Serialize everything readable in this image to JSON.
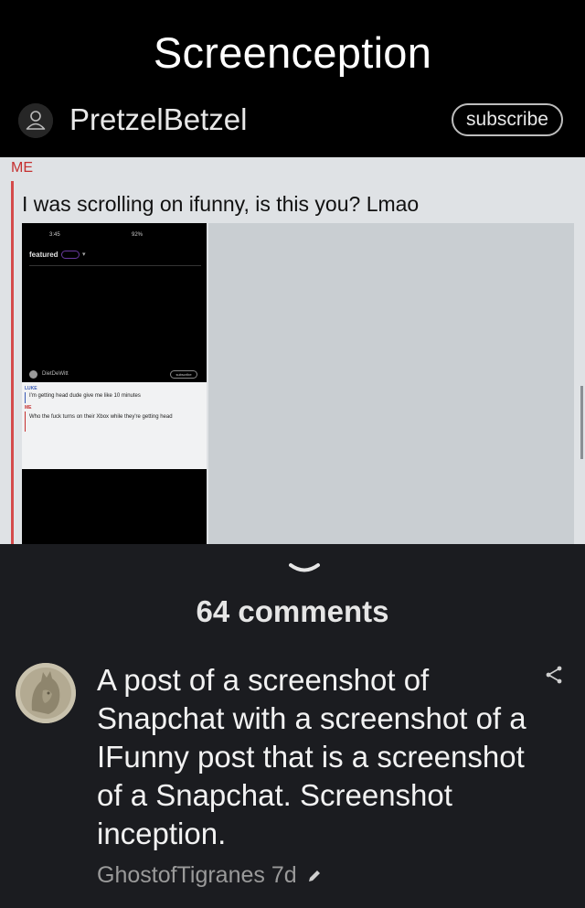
{
  "post": {
    "title": "Screenception",
    "author": "PretzelBetzel",
    "subscribe_label": "subscribe"
  },
  "snapchat": {
    "sender_label": "ME",
    "message": "I was scrolling on ifunny, is this you? Lmao",
    "nested_screenshot": {
      "status_left": "3:45",
      "status_right": "92%",
      "tab_label": "featured",
      "poster": "DietDeWitt",
      "subscribe_label": "subscribe",
      "first_sender": "LUKE",
      "first_message": "I'm getting head dude give me like 10 minutes",
      "second_sender": "ME",
      "second_message": "Who the fuck turns on their Xbox while they're getting head"
    }
  },
  "comments_section": {
    "count_label": "64 comments",
    "comment": {
      "text": "A post of a screenshot of Snapchat with a screenshot of a IFunny post that is a screenshot of a Snapchat. Screenshot inception.",
      "author": "GhostofTigranes",
      "age": "7d"
    }
  },
  "icons": {
    "avatar": "user-outline-icon",
    "collapse": "chevron-down-icon",
    "share": "share-icon",
    "edited": "pencil-icon"
  }
}
